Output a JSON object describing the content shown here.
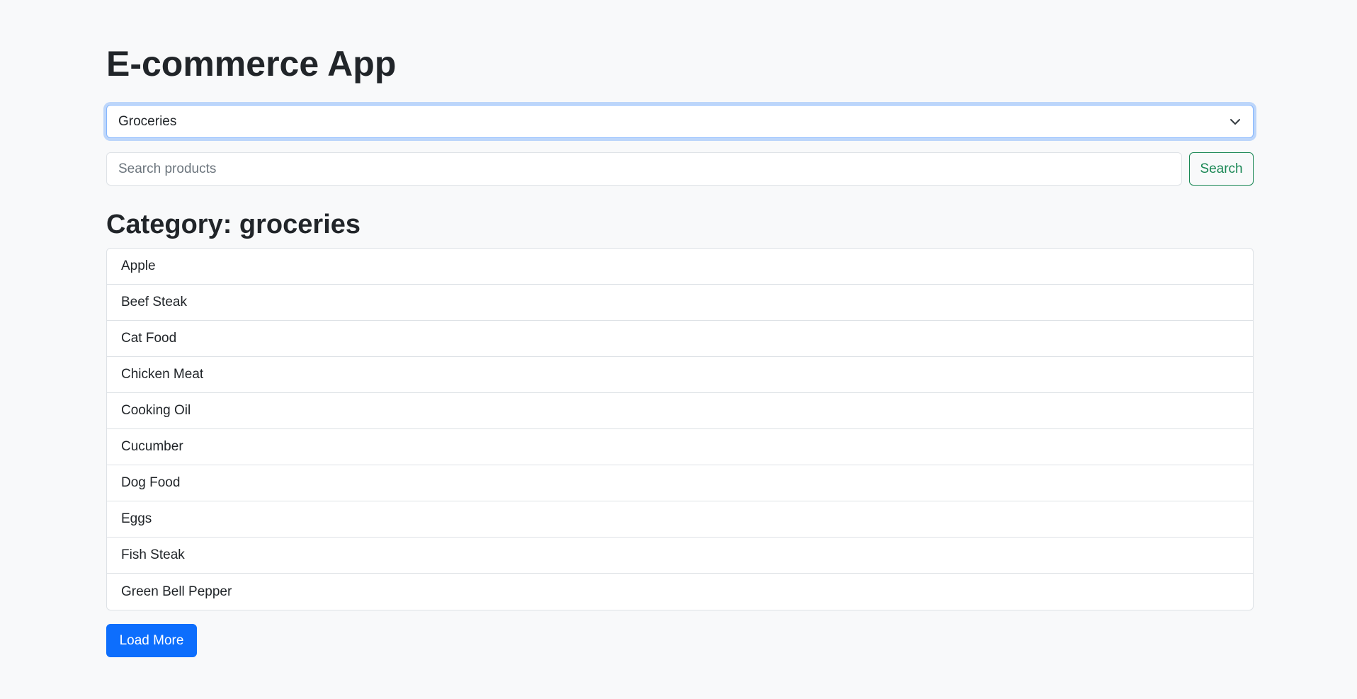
{
  "app": {
    "title": "E-commerce App"
  },
  "category_select": {
    "selected": "Groceries",
    "icon": "chevron-down-icon"
  },
  "search": {
    "placeholder": "Search products",
    "value": "",
    "button_label": "Search"
  },
  "category_heading": "Category: groceries",
  "products": [
    "Apple",
    "Beef Steak",
    "Cat Food",
    "Chicken Meat",
    "Cooking Oil",
    "Cucumber",
    "Dog Food",
    "Eggs",
    "Fish Steak",
    "Green Bell Pepper"
  ],
  "load_more_label": "Load More",
  "colors": {
    "background": "#f8f9fa",
    "primary": "#0d6efd",
    "success": "#198754",
    "focus_border": "#86b7fe",
    "border": "#dee2e6",
    "text": "#212529"
  }
}
